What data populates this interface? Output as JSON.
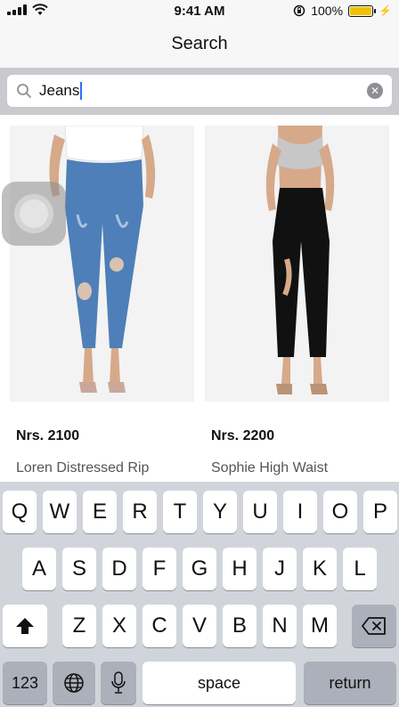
{
  "status_bar": {
    "time": "9:41 AM",
    "battery": "100%",
    "battery_level": 1.0
  },
  "nav": {
    "title": "Search"
  },
  "search": {
    "value": "Jeans",
    "placeholder": "Search"
  },
  "products": [
    {
      "price": "Nrs. 2100",
      "name": "Loren Distressed Rip",
      "image": "blue-distressed-skinny-jeans"
    },
    {
      "price": "Nrs. 2200",
      "name": "Sophie High Waist",
      "image": "black-ripped-high-waist-jeans"
    }
  ],
  "keyboard": {
    "row1": [
      "Q",
      "W",
      "E",
      "R",
      "T",
      "Y",
      "U",
      "I",
      "O",
      "P"
    ],
    "row2": [
      "A",
      "S",
      "D",
      "F",
      "G",
      "H",
      "J",
      "K",
      "L"
    ],
    "row3": [
      "Z",
      "X",
      "C",
      "V",
      "B",
      "N",
      "M"
    ],
    "numbers_label": "123",
    "space_label": "space",
    "return_label": "return"
  },
  "icons": {
    "search": "search-icon",
    "clear": "clear-icon",
    "shift": "shift-icon",
    "backspace": "backspace-icon",
    "globe": "globe-icon",
    "microphone": "microphone-icon",
    "wifi": "wifi-icon",
    "battery": "battery-icon"
  },
  "colors": {
    "caret": "#2f6cff",
    "battery": "#f2c200",
    "keyboard_bg": "#d1d5db"
  }
}
